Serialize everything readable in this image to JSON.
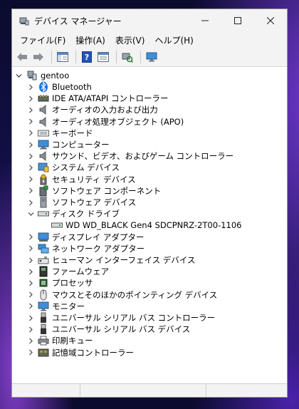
{
  "window": {
    "title": "デバイス マネージャー"
  },
  "menu": [
    "ファイル(F)",
    "操作(A)",
    "表示(V)",
    "ヘルプ(H)"
  ],
  "tree": {
    "root": "gentoo",
    "categories": [
      {
        "label": "Bluetooth",
        "icon": "bluetooth-icon"
      },
      {
        "label": "IDE ATA/ATAPI コントローラー",
        "icon": "ide-controller-icon"
      },
      {
        "label": "オーディオの入力および出力",
        "icon": "speaker-icon"
      },
      {
        "label": "オーディオ処理オブジェクト (APO)",
        "icon": "speaker-icon"
      },
      {
        "label": "キーボード",
        "icon": "keyboard-icon"
      },
      {
        "label": "コンピューター",
        "icon": "computer-icon"
      },
      {
        "label": "サウンド、ビデオ、およびゲーム コントローラー",
        "icon": "speaker-icon"
      },
      {
        "label": "システム デバイス",
        "icon": "system-device-icon"
      },
      {
        "label": "セキュリティ デバイス",
        "icon": "security-key-icon"
      },
      {
        "label": "ソフトウェア コンポーネント",
        "icon": "software-component-icon"
      },
      {
        "label": "ソフトウェア デバイス",
        "icon": "software-device-icon"
      },
      {
        "label": "ディスク ドライブ",
        "icon": "disk-drive-icon",
        "expanded": true,
        "children": [
          "WD WD_BLACK Gen4 SDCPNRZ-2T00-1106"
        ]
      },
      {
        "label": "ディスプレイ アダプター",
        "icon": "display-adapter-icon"
      },
      {
        "label": "ネットワーク アダプター",
        "icon": "network-adapter-icon"
      },
      {
        "label": "ヒューマン インターフェイス デバイス",
        "icon": "hid-icon"
      },
      {
        "label": "ファームウェア",
        "icon": "firmware-icon"
      },
      {
        "label": "プロセッサ",
        "icon": "processor-icon"
      },
      {
        "label": "マウスとそのほかのポインティング デバイス",
        "icon": "mouse-icon"
      },
      {
        "label": "モニター",
        "icon": "monitor-icon"
      },
      {
        "label": "ユニバーサル シリアル バス コントローラー",
        "icon": "usb-icon"
      },
      {
        "label": "ユニバーサル シリアル バス デバイス",
        "icon": "usb-icon"
      },
      {
        "label": "印刷キュー",
        "icon": "printer-icon"
      },
      {
        "label": "記憶域コントローラー",
        "icon": "storage-controller-icon"
      }
    ]
  }
}
